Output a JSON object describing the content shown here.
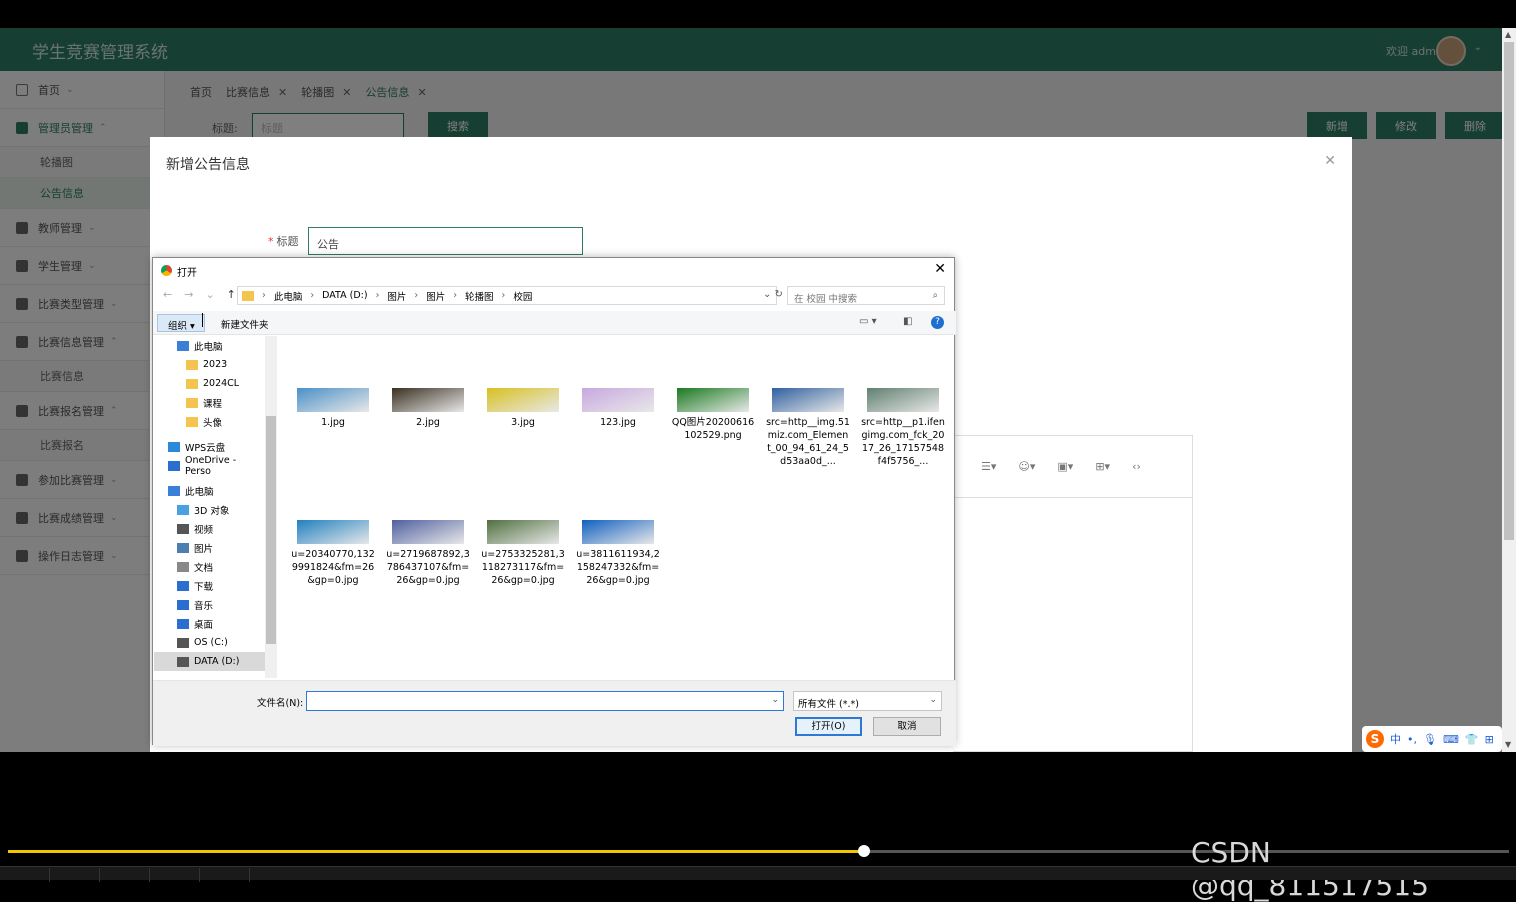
{
  "app": {
    "title": "学生竞赛管理系统",
    "welcome": "欢迎 admin"
  },
  "sidebar": {
    "items": [
      {
        "label": "首页"
      },
      {
        "label": "管理员管理",
        "sub": [
          "轮播图",
          "公告信息"
        ]
      },
      {
        "label": "教师管理"
      },
      {
        "label": "学生管理"
      },
      {
        "label": "比赛类型管理"
      },
      {
        "label": "比赛信息管理",
        "sub": [
          "比赛信息"
        ]
      },
      {
        "label": "比赛报名管理",
        "sub": [
          "比赛报名"
        ]
      },
      {
        "label": "参加比赛管理"
      },
      {
        "label": "比赛成绩管理"
      },
      {
        "label": "操作日志管理"
      }
    ]
  },
  "tabs": [
    "首页",
    "比赛信息",
    "轮播图",
    "公告信息"
  ],
  "search": {
    "label": "标题:",
    "placeholder": "标题",
    "button": "搜索"
  },
  "actions": {
    "add": "新增",
    "edit": "修改",
    "delete": "删除"
  },
  "modal": {
    "title": "新增公告信息",
    "field_label": "标题",
    "field_value": "公告"
  },
  "dialog": {
    "title": "打开",
    "breadcrumb": [
      "此电脑",
      "DATA (D:)",
      "图片",
      "图片",
      "轮播图",
      "校园"
    ],
    "search_placeholder": "在 校园 中搜索",
    "organize": "组织",
    "new_folder": "新建文件夹",
    "tree": [
      "此电脑",
      "2023",
      "2024CL",
      "课程",
      "头像",
      "WPS云盘",
      "OneDrive - Perso",
      "此电脑",
      "3D 对象",
      "视频",
      "图片",
      "文档",
      "下载",
      "音乐",
      "桌面",
      "OS (C:)",
      "DATA (D:)"
    ],
    "files": [
      {
        "name": "1.jpg",
        "color": "#4a90c8"
      },
      {
        "name": "2.jpg",
        "color": "#3a3020"
      },
      {
        "name": "3.jpg",
        "color": "#d8c020"
      },
      {
        "name": "123.jpg",
        "color": "#c8a8e0"
      },
      {
        "name": "QQ图片20200616102529.png",
        "color": "#1a7a20"
      },
      {
        "name": "src=http__img.51miz.com_Element_00_94_61_24_5d53aa0d_...",
        "color": "#3060a0"
      },
      {
        "name": "src=http__p1.ifengimg.com_fck_2017_26_17157548f4f5756_...",
        "color": "#608070"
      },
      {
        "name": "u=20340770,1329991824&fm=26&gp=0.jpg",
        "color": "#2080c0"
      },
      {
        "name": "u=2719687892,3786437107&fm=26&gp=0.jpg",
        "color": "#5060a0"
      },
      {
        "name": "u=2753325281,3118273117&fm=26&gp=0.jpg",
        "color": "#507040"
      },
      {
        "name": "u=3811611934,2158247332&fm=26&gp=0.jpg",
        "color": "#1060c0"
      }
    ],
    "filename_label": "文件名(N):",
    "filetype": "所有文件 (*.*)",
    "open": "打开(O)",
    "cancel": "取消"
  },
  "watermark": "CSDN @qq_811517515",
  "video_progress": 0.57
}
